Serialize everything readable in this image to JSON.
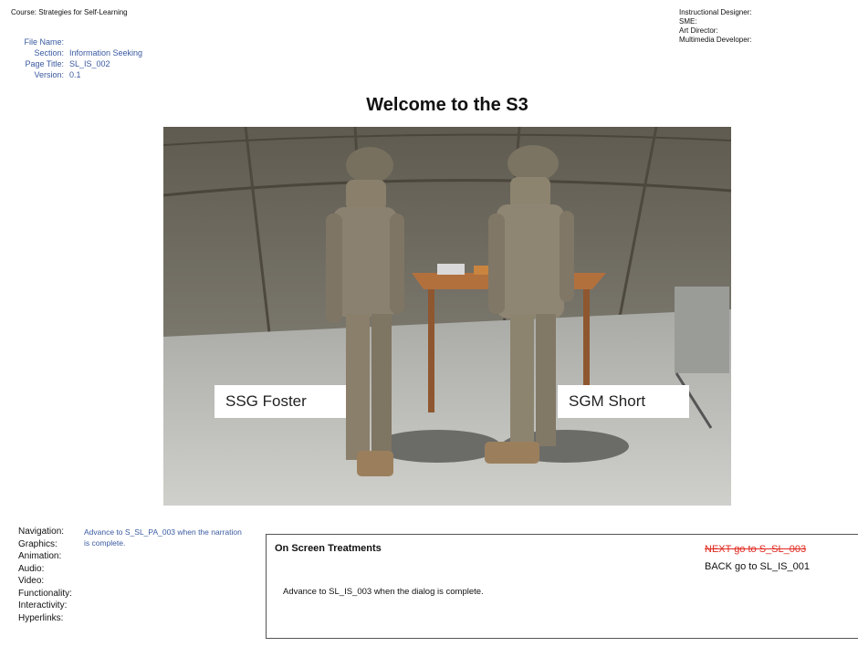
{
  "header": {
    "course": "Course: Strategies for Self-Learning",
    "file_meta": [
      {
        "key": "File Name:",
        "value": ""
      },
      {
        "key": "Section:",
        "value": "Information Seeking"
      },
      {
        "key": "Page Title:",
        "value": "SL_IS_002"
      },
      {
        "key": "Version:",
        "value": "0.1"
      }
    ],
    "roles": [
      "Instructional Designer:",
      "SME:",
      "Art Director:",
      "Multimedia Developer:"
    ]
  },
  "page_title": "Welcome to the S3",
  "scene": {
    "label_left": "SSG Foster",
    "label_right": "SGM Short"
  },
  "fields": {
    "labels": [
      "Navigation:",
      "Graphics:",
      "Animation:",
      "Audio:",
      "Video:",
      "Functionality:",
      "Interactivity:",
      "Hyperlinks:"
    ],
    "navigation_note": "Advance to S_SL_PA_003 when the narration is complete."
  },
  "treatments": {
    "heading": "On Screen Treatments",
    "body": "Advance to SL_IS_003 when the dialog is complete.",
    "next_link": "NEXT go to S_SL_003",
    "back_link": "BACK go to SL_IS_001"
  },
  "colors": {
    "link_blue": "#3a5aa0",
    "strike_red": "#e0281e"
  }
}
